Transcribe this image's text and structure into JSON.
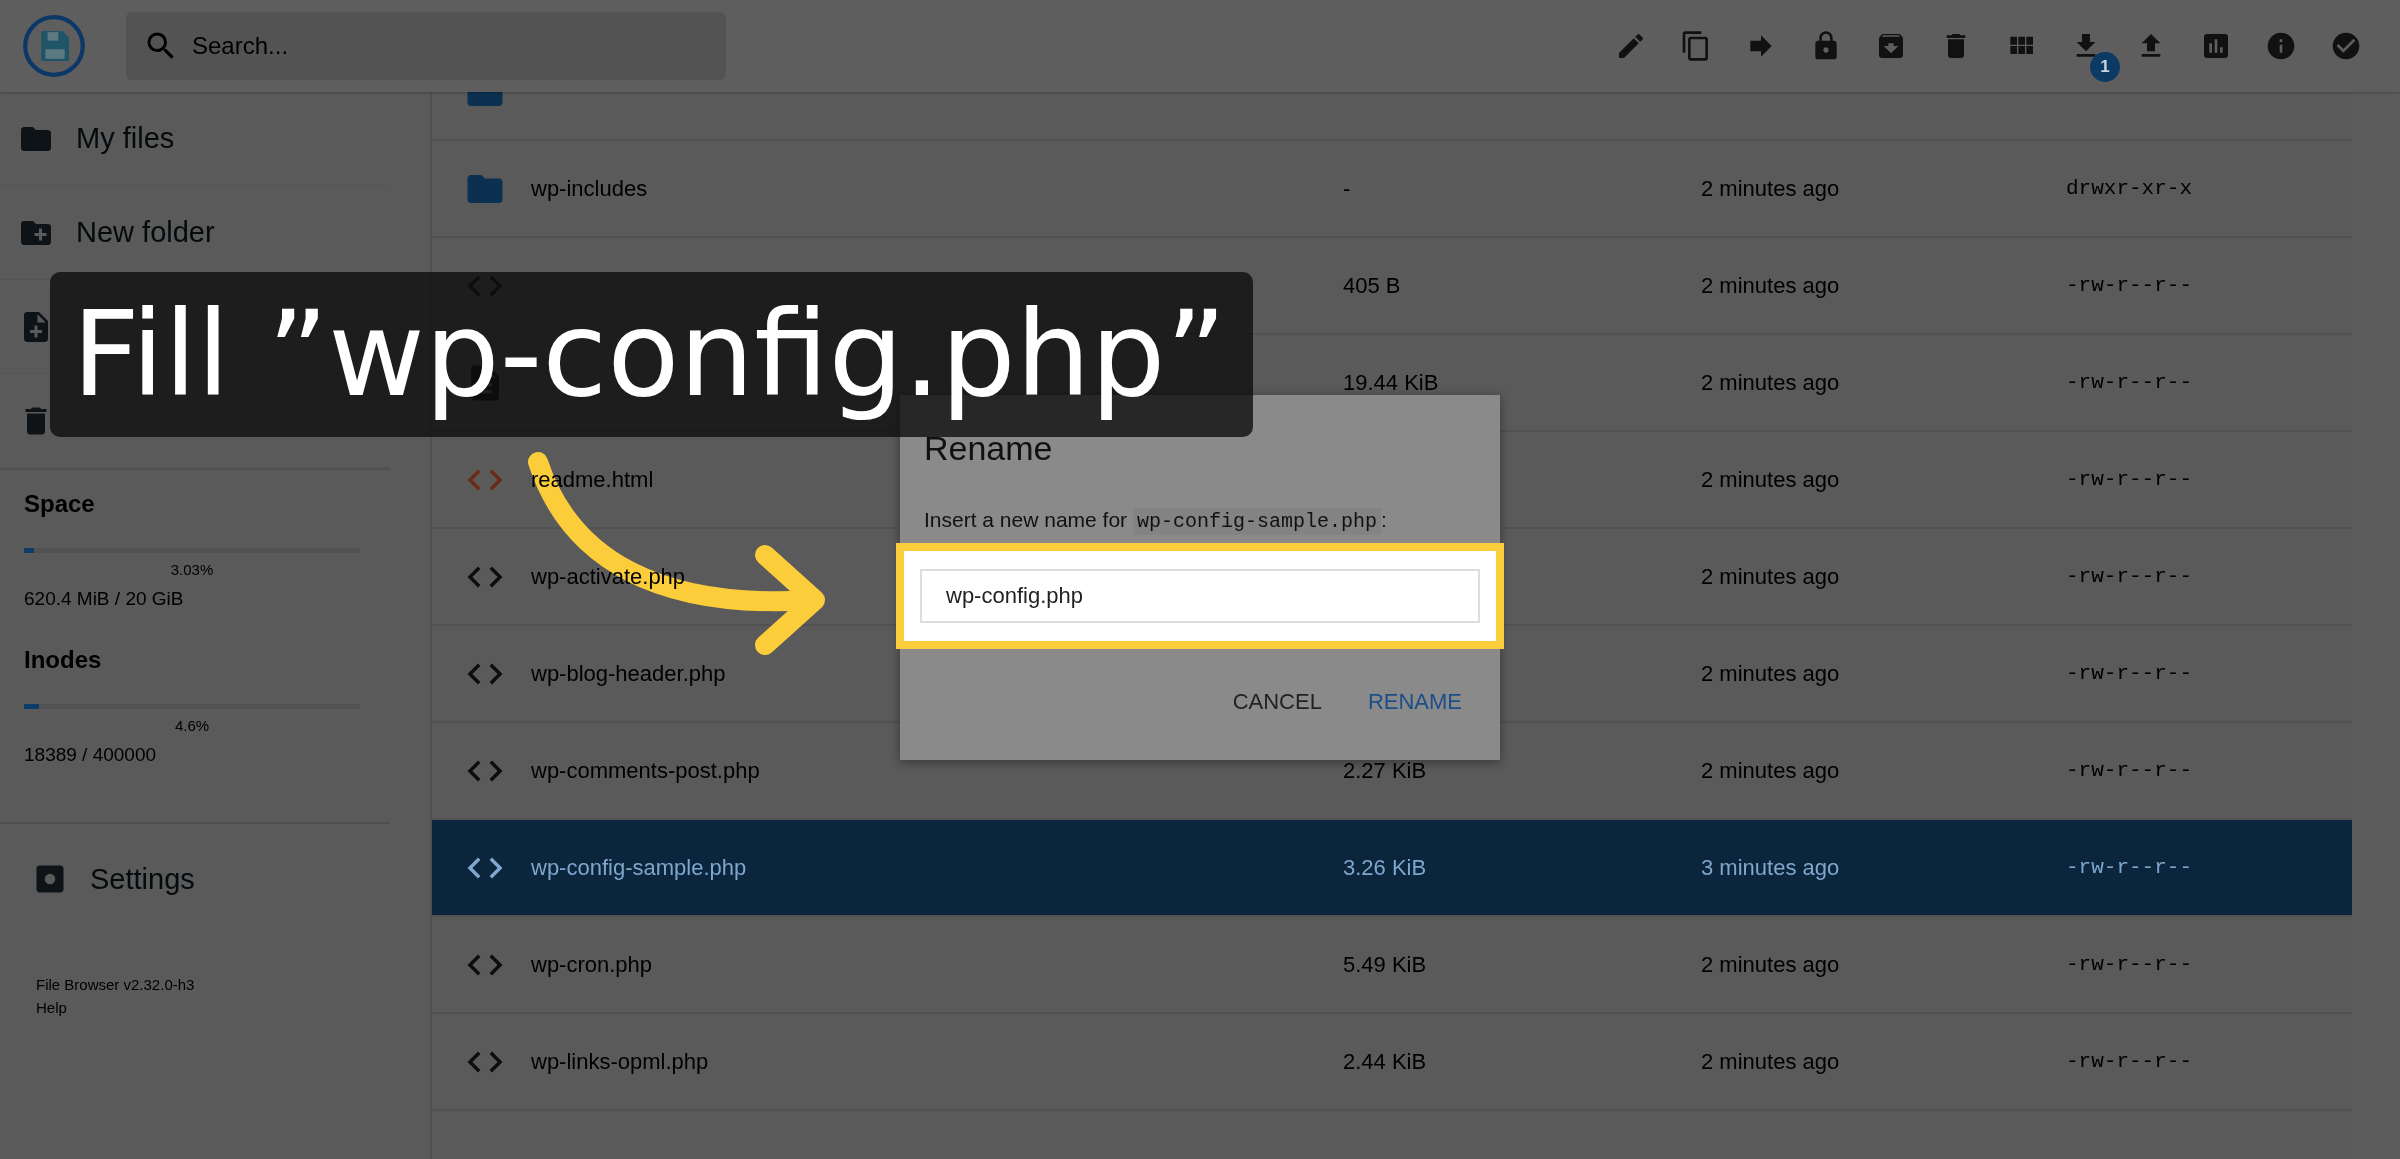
{
  "header": {
    "search": {
      "placeholder": "Search..."
    },
    "toolbar": [
      {
        "kind": "edit"
      },
      {
        "kind": "copy"
      },
      {
        "kind": "move"
      },
      {
        "kind": "lock"
      },
      {
        "kind": "archive"
      },
      {
        "kind": "delete"
      },
      {
        "kind": "grid"
      },
      {
        "kind": "download",
        "badge": "1"
      },
      {
        "kind": "upload"
      },
      {
        "kind": "chart"
      },
      {
        "kind": "info"
      },
      {
        "kind": "check"
      }
    ]
  },
  "sidebar": {
    "nav": [
      {
        "kind": "folder",
        "label": "My files"
      },
      {
        "kind": "new-folder",
        "label": "New folder"
      },
      {
        "kind": "new-file"
      },
      {
        "kind": "trash"
      }
    ],
    "usage": [
      {
        "title": "Space",
        "level": 0.0303,
        "percent": "3.03%",
        "detail": "620.4 MiB / 20 GiB"
      },
      {
        "title": "Inodes",
        "level": 0.046,
        "percent": "4.6%",
        "detail": "18389 / 400000"
      }
    ],
    "settings": "Settings",
    "version": "File Browser v2.32.0-h3",
    "help": "Help"
  },
  "files": [
    {
      "kind": "folder",
      "selected": false
    },
    {
      "kind": "folder",
      "name": "wp-includes",
      "size": "-",
      "modified": "2 minutes ago",
      "permissions": "drwxr-xr-x",
      "selected": false
    },
    {
      "kind": "code",
      "size": "405 B",
      "modified": "2 minutes ago",
      "permissions": "-rw-r--r--",
      "selected": false
    },
    {
      "kind": "text",
      "size": "19.44 KiB",
      "modified": "2 minutes ago",
      "permissions": "-rw-r--r--",
      "selected": false
    },
    {
      "kind": "html",
      "name": "readme.html",
      "modified": "2 minutes ago",
      "permissions": "-rw-r--r--",
      "selected": false
    },
    {
      "kind": "code",
      "name": "wp-activate.php",
      "modified": "2 minutes ago",
      "permissions": "-rw-r--r--",
      "selected": false
    },
    {
      "kind": "code",
      "name": "wp-blog-header.php",
      "modified": "2 minutes ago",
      "permissions": "-rw-r--r--",
      "selected": false
    },
    {
      "kind": "code",
      "name": "wp-comments-post.php",
      "size": "2.27 KiB",
      "modified": "2 minutes ago",
      "permissions": "-rw-r--r--",
      "selected": false
    },
    {
      "kind": "code",
      "name": "wp-config-sample.php",
      "size": "3.26 KiB",
      "modified": "3 minutes ago",
      "permissions": "-rw-r--r--",
      "selected": true
    },
    {
      "kind": "code",
      "name": "wp-cron.php",
      "size": "5.49 KiB",
      "modified": "2 minutes ago",
      "permissions": "-rw-r--r--",
      "selected": false
    },
    {
      "kind": "code",
      "name": "wp-links-opml.php",
      "size": "2.44 KiB",
      "modified": "2 minutes ago",
      "permissions": "-rw-r--r--",
      "selected": false
    }
  ],
  "dialog": {
    "title": "Rename",
    "prompt": "Insert a new name for ",
    "filename": "wp-config-sample.php",
    "prompt_end": ":",
    "value": "wp-config.php",
    "buttons": [
      {
        "kind": "cancel",
        "label": "CANCEL"
      },
      {
        "kind": "primary",
        "label": "RENAME"
      }
    ]
  },
  "annotation": {
    "text": "Fill ”wp-config.php”"
  }
}
